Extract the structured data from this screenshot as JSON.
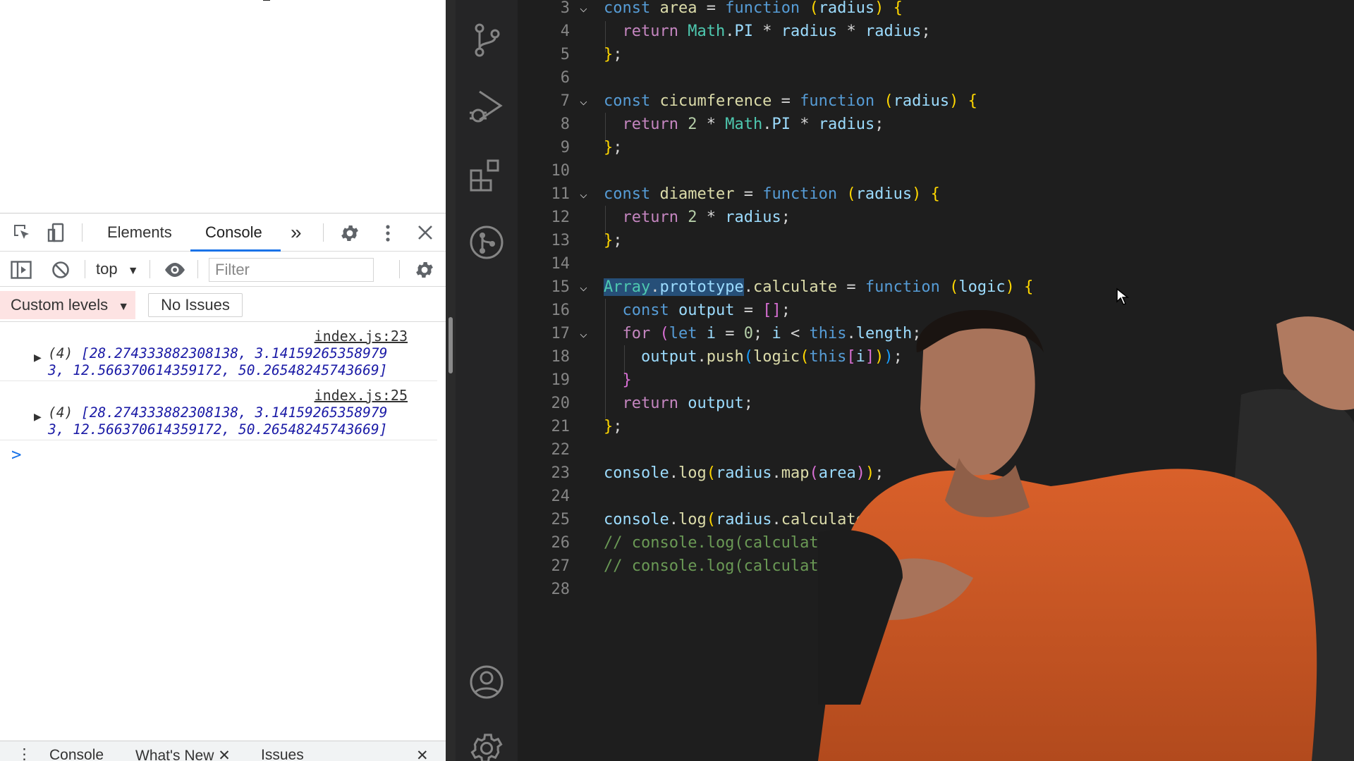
{
  "devtools": {
    "tabs": [
      "Elements",
      "Console"
    ],
    "more_tabs": "»",
    "context": "top",
    "filter_placeholder": "Filter",
    "levels": "Custom levels",
    "issues": "No Issues",
    "console": {
      "entries": [
        {
          "source": "index.js:23",
          "count": "(4)",
          "line1": "[28.274333882308138, 3.14159265358979",
          "line2": "3, 12.566370614359172, 50.26548245743669]"
        },
        {
          "source": "index.js:25",
          "count": "(4)",
          "line1": "[28.274333882308138, 3.14159265358979",
          "line2": "3, 12.566370614359172, 50.26548245743669]"
        }
      ],
      "prompt": ">"
    },
    "drawer_tabs": [
      "Console",
      "What's New",
      "Issues"
    ]
  },
  "editor": {
    "line_numbers": [
      "3",
      "4",
      "5",
      "6",
      "7",
      "8",
      "9",
      "10",
      "11",
      "12",
      "13",
      "14",
      "15",
      "16",
      "17",
      "18",
      "19",
      "20",
      "21",
      "22",
      "23",
      "24",
      "25",
      "26",
      "27",
      "28"
    ]
  },
  "icons": {
    "inspect": "inspect-element-icon",
    "device": "device-toolbar-icon",
    "settings": "gear-icon",
    "menu": "kebab-menu-icon",
    "close": "close-icon",
    "sidebar": "sidebar-toggle-icon",
    "clear": "clear-console-icon",
    "eye": "eye-icon",
    "source_control": "source-control-icon",
    "run_debug": "run-debug-icon",
    "extensions": "extensions-icon",
    "git_graph": "git-graph-icon",
    "account": "account-icon",
    "manage": "manage-gear-icon"
  },
  "colors": {
    "editor_bg": "#1e1e1e",
    "keyword": "#569cd6",
    "function": "#dcdcaa",
    "variable": "#9cdcfe",
    "comment": "#6a9955",
    "accent": "#1a73e8"
  }
}
